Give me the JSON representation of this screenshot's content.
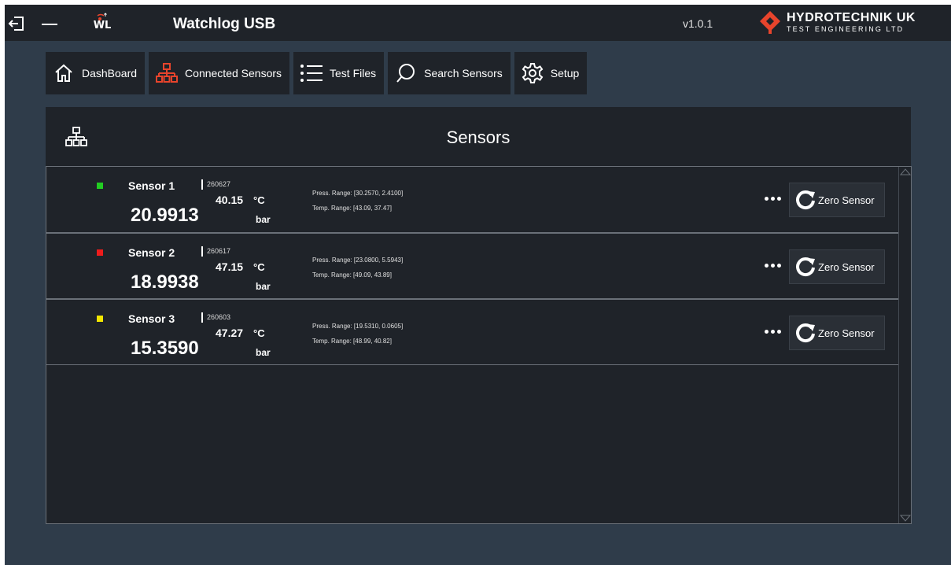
{
  "titlebar": {
    "app_title": "Watchlog USB",
    "logo_text": "WL",
    "version": "v1.0.1",
    "brand_name": "HYDROTECHNIK UK",
    "brand_sub": "TEST ENGINEERING LTD"
  },
  "nav": {
    "items": [
      {
        "label": "DashBoard",
        "icon": "home-icon"
      },
      {
        "label": "Connected Sensors",
        "icon": "network-icon"
      },
      {
        "label": "Test Files",
        "icon": "list-icon"
      },
      {
        "label": "Search Sensors",
        "icon": "search-icon"
      },
      {
        "label": "Setup",
        "icon": "gear-icon"
      }
    ]
  },
  "panel": {
    "title": "Sensors"
  },
  "sensors": [
    {
      "name": "Sensor 1",
      "serial": "260627",
      "temp": "40.15",
      "temp_unit": "°C",
      "pressure": "20.9913",
      "pressure_unit": "bar",
      "press_range": "Press. Range: [30.2570, 2.4100]",
      "temp_range": "Temp. Range: [43.09, 37.47]",
      "status_color": "#22cc22",
      "zero_label": "Zero Sensor"
    },
    {
      "name": "Sensor 2",
      "serial": "260617",
      "temp": "47.15",
      "temp_unit": "°C",
      "pressure": "18.9938",
      "pressure_unit": "bar",
      "press_range": "Press. Range: [23.0800, 5.5943]",
      "temp_range": "Temp. Range: [49.09, 43.89]",
      "status_color": "#ee1c1c",
      "zero_label": "Zero Sensor"
    },
    {
      "name": "Sensor 3",
      "serial": "260603",
      "temp": "47.27",
      "temp_unit": "°C",
      "pressure": "15.3590",
      "pressure_unit": "bar",
      "press_range": "Press. Range: [19.5310, 0.0605]",
      "temp_range": "Temp. Range: [48.99, 40.82]",
      "status_color": "#f2e600",
      "zero_label": "Zero Sensor"
    }
  ],
  "colors": {
    "accent": "#e8442c",
    "background": "#2f3c4a",
    "panel": "#1f2329"
  }
}
